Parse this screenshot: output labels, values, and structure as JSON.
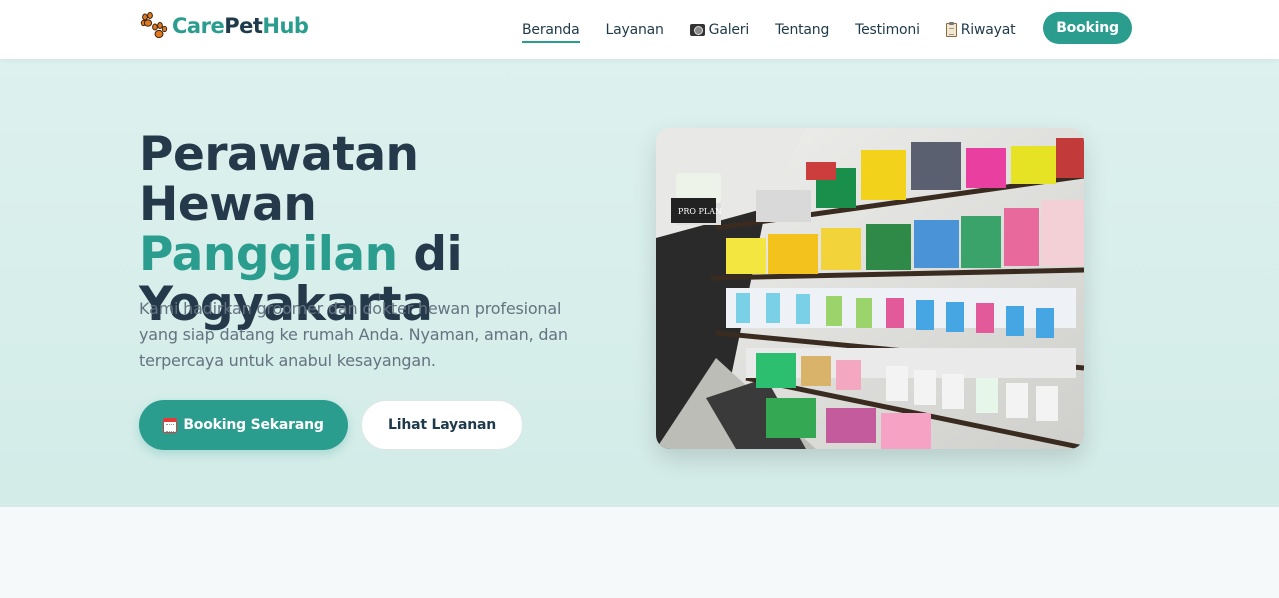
{
  "brand": {
    "part1": "Care",
    "part2": "Pet",
    "part3": "Hub",
    "icon": "paw-icon"
  },
  "nav": {
    "items": [
      {
        "label": "Beranda",
        "active": true
      },
      {
        "label": "Layanan"
      },
      {
        "label": "Galeri",
        "icon": "camera-icon"
      },
      {
        "label": "Tentang"
      },
      {
        "label": "Testimoni"
      },
      {
        "label": "Riwayat",
        "icon": "clipboard-icon"
      }
    ],
    "cta": "Booking"
  },
  "hero": {
    "title_line1": "Perawatan Hewan",
    "title_accent": "Panggilan",
    "title_di": " di",
    "title_line3": "Yogyakarta",
    "description": "Kami hadirkan groomer dan dokter hewan profesional yang siap datang ke rumah Anda. Nyaman, aman, dan terpercaya untuk anabul kesayangan.",
    "primary_button": "Booking Sekarang",
    "primary_icon": "calendar-icon",
    "secondary_button": "Lihat Layanan"
  },
  "photo": {
    "sign_text": "PRO PLAN"
  },
  "colors": {
    "accent": "#2a9d8f",
    "dark": "#24394a",
    "hero_bg": "#d8efeb"
  }
}
